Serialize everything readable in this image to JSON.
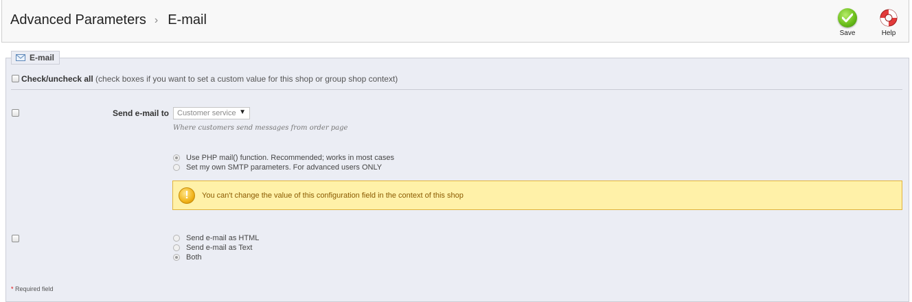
{
  "header": {
    "breadcrumb_parent": "Advanced Parameters",
    "breadcrumb_separator": "›",
    "breadcrumb_current": "E-mail",
    "save_label": "Save",
    "help_label": "Help"
  },
  "fieldset": {
    "legend": "E-mail",
    "check_all_bold": "Check/uncheck all",
    "check_all_hint": " (check boxes if you want to set a custom value for this shop or group shop context)",
    "send_to_label": "Send e-mail to",
    "send_to_value": "Customer service",
    "send_to_hint": "Where customers send messages from order page",
    "mail_method_options": [
      "Use PHP mail() function. Recommended; works in most cases",
      "Set my own SMTP parameters. For advanced users ONLY"
    ],
    "mail_method_selected": 0,
    "warning_text": "You can't change the value of this configuration field in the context of this shop",
    "format_options": [
      "Send e-mail as HTML",
      "Send e-mail as Text",
      "Both"
    ],
    "format_selected": 2,
    "required_star": "*",
    "required_text": " Required field"
  },
  "colors": {
    "fieldset_bg": "#ebedf4",
    "warning_bg": "#fff1a8",
    "warning_border": "#e1b23a",
    "save_green": "#6cbf1c"
  },
  "icons": {
    "save": "save-check-icon",
    "help": "lifebuoy-icon",
    "legend": "envelope-icon",
    "warning": "warning-icon"
  }
}
